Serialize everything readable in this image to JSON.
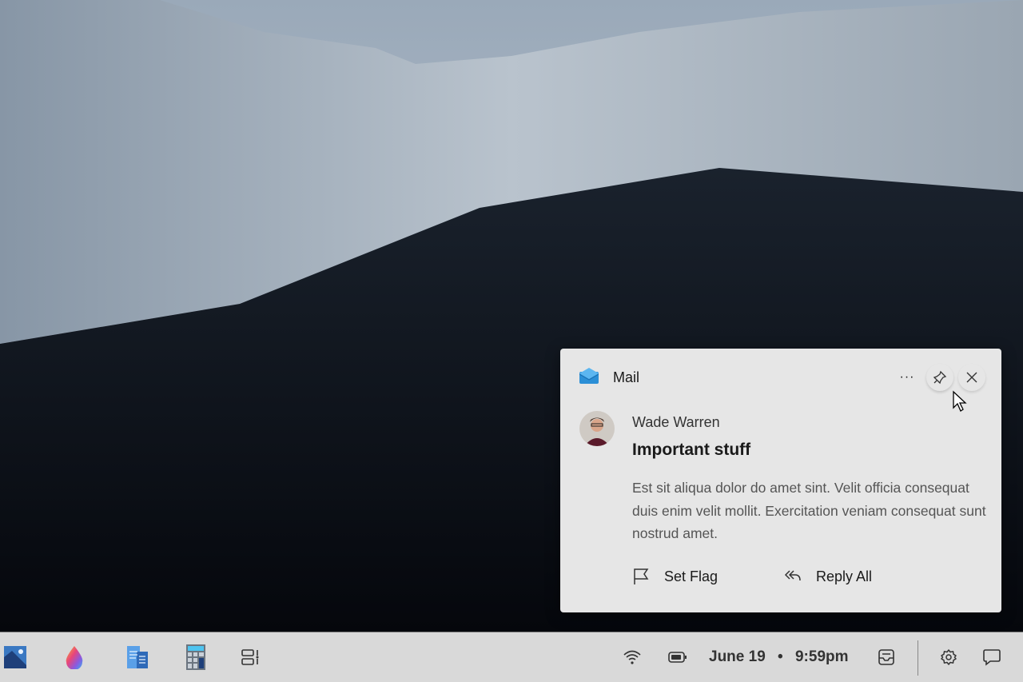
{
  "notification": {
    "app_name": "Mail",
    "sender": "Wade Warren",
    "subject": "Important stuff",
    "body": "Est sit aliqua dolor do amet sint. Velit officia consequat duis enim velit mollit. Exercitation veniam consequat sunt nostrud amet.",
    "actions": [
      {
        "label": "Set Flag",
        "icon": "flag-icon"
      },
      {
        "label": "Reply All",
        "icon": "reply-all-icon"
      }
    ],
    "controls": [
      "more-icon",
      "pin-icon",
      "close-icon"
    ]
  },
  "taskbar": {
    "apps": [
      "photos-icon",
      "paint-icon",
      "docs-icon",
      "calculator-icon",
      "widgets-icon"
    ],
    "date": "June 19",
    "separator": "•",
    "time": "9:59pm",
    "accent": "#2b8fd6"
  }
}
